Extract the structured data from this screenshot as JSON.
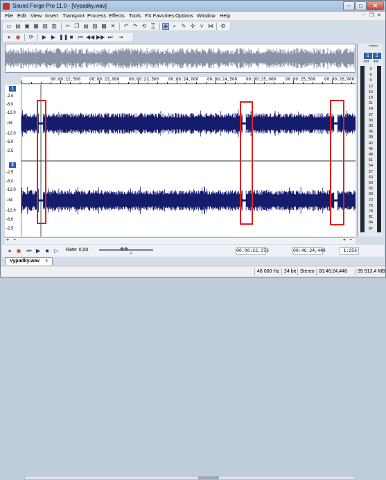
{
  "window": {
    "title": "Sound Forge Pro 11.0 - [Vypadky.wav]",
    "min": "–",
    "max": "□",
    "close": "✕"
  },
  "menu": [
    "File",
    "Edit",
    "View",
    "Insert",
    "Transport",
    "Process",
    "Effects",
    "Tools",
    "FX Favorites",
    "Options",
    "Window",
    "Help"
  ],
  "mdi_controls": [
    "–",
    "❐",
    "✕"
  ],
  "ruler": {
    "labels": [
      "00:00:22,500",
      "00:00:23,000",
      "00:00:23,500",
      "00:00:24,000",
      "00:00:24,500",
      "00:00:25,000",
      "00:00:25,500",
      "00:00:26,000"
    ]
  },
  "channel1": {
    "num": "1",
    "labels": [
      "-2.5",
      "-6.0",
      "-12.0",
      "-Inf.",
      "-12.0",
      "-6.0",
      "-2.5"
    ]
  },
  "channel2": {
    "num": "2",
    "labels": [
      "-2.5",
      "-6.0",
      "-12.0",
      "-Inf.",
      "-12.0",
      "-6.0",
      "-2.5"
    ]
  },
  "meter": {
    "ch1": "1",
    "ch2": "2",
    "peak_l": "-Inf.",
    "peak_r": "-Inf.",
    "header": "******",
    "labels": [
      "3",
      "6",
      "9",
      "12",
      "15",
      "18",
      "21",
      "24",
      "27",
      "30",
      "33",
      "36",
      "39",
      "42",
      "45",
      "48",
      "51",
      "54",
      "57",
      "60",
      "63",
      "66",
      "69",
      "72",
      "75",
      "78",
      "81",
      "84",
      "87"
    ]
  },
  "transport": {
    "rate_label": "Rate: 0,00",
    "cursor": "00:00:22,373",
    "length": "00:46:24,448",
    "zoom": "1:256"
  },
  "tab": {
    "file": "Vypadky.wav",
    "close": "×"
  },
  "status": {
    "sample_rate": "48 000 Hz",
    "bit_depth": "24 bit",
    "channels": "Stereo",
    "duration": "00:46:24,448",
    "free_space": "35 913,4 MB"
  },
  "colors": {
    "waveform": "#141c6e",
    "highlight": "#e02020",
    "channel_badge": "#2b5fb0"
  }
}
